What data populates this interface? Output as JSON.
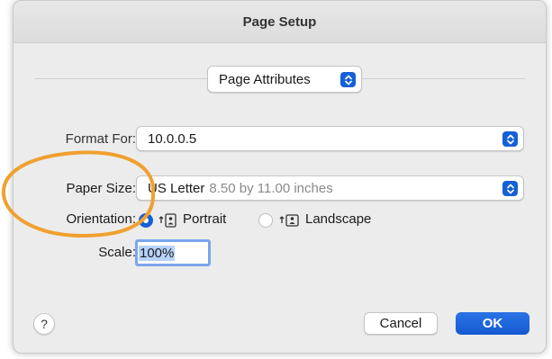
{
  "window": {
    "title": "Page Setup"
  },
  "page_attributes_popup": {
    "label": "Page Attributes"
  },
  "form": {
    "format_for": {
      "label": "Format For:",
      "value": "10.0.0.5"
    },
    "paper_size": {
      "label": "Paper Size:",
      "value": "US Letter",
      "detail": "8.50 by 11.00 inches"
    },
    "orientation": {
      "label": "Orientation:",
      "options": [
        {
          "label": "Portrait",
          "selected": true
        },
        {
          "label": "Landscape",
          "selected": false
        }
      ]
    },
    "scale": {
      "label": "Scale:",
      "value": "100%"
    }
  },
  "buttons": {
    "help": "?",
    "cancel": "Cancel",
    "ok": "OK"
  },
  "colors": {
    "accent": "#1560d6",
    "annotation": "#f0a030"
  },
  "icons": {
    "popup_stepper": "up-down-chevron-icon",
    "portrait": "portrait-orientation-icon",
    "landscape": "landscape-orientation-icon"
  }
}
